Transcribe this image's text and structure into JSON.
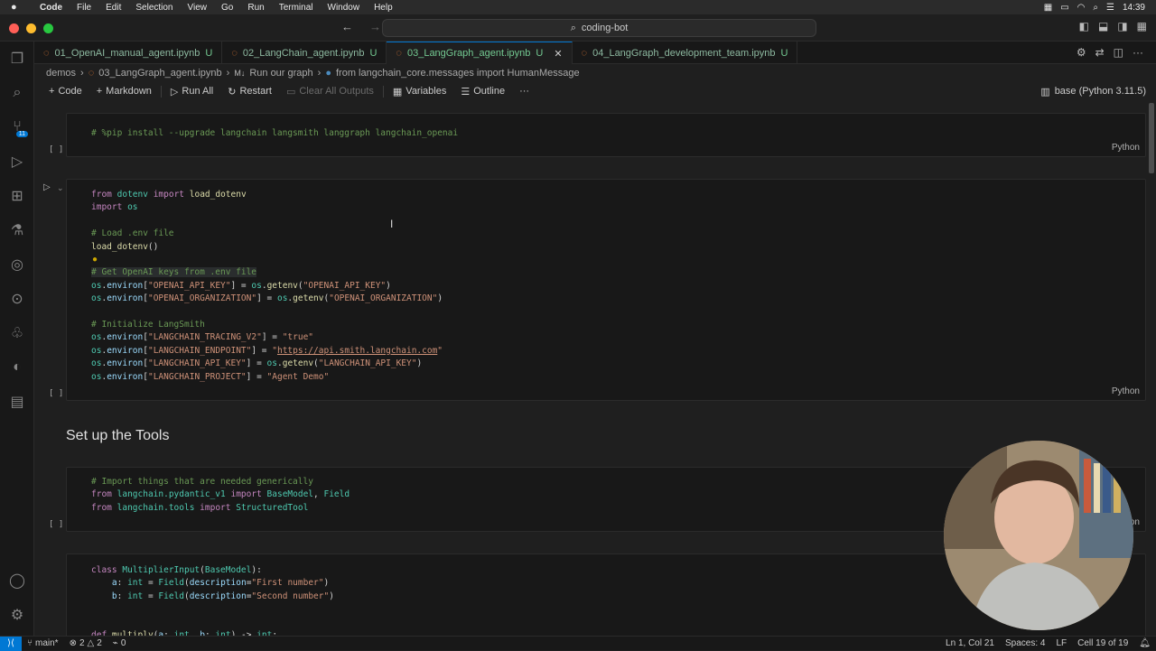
{
  "menubar": {
    "apple": "",
    "items": [
      "Code",
      "File",
      "Edit",
      "Selection",
      "View",
      "Go",
      "Run",
      "Terminal",
      "Window",
      "Help"
    ],
    "clock": "14:39"
  },
  "titlebar": {
    "search_text": "coding-bot"
  },
  "tabs": [
    {
      "label": "01_OpenAI_manual_agent.ipynb",
      "status": "U"
    },
    {
      "label": "02_LangChain_agent.ipynb",
      "status": "U"
    },
    {
      "label": "03_LangGraph_agent.ipynb",
      "status": "U",
      "active": true
    },
    {
      "label": "04_LangGraph_development_team.ipynb",
      "status": "U"
    }
  ],
  "activity": {
    "scm_badge": "11"
  },
  "breadcrumbs": {
    "folder": "demos",
    "file": "03_LangGraph_agent.ipynb",
    "md_section": "Run our graph",
    "symbol": "from langchain_core.messages import HumanMessage"
  },
  "toolbar": {
    "code": "Code",
    "markdown": "Markdown",
    "run_all": "Run All",
    "restart": "Restart",
    "clear_outputs": "Clear All Outputs",
    "variables": "Variables",
    "outline": "Outline",
    "more": "···",
    "kernel": "base (Python 3.11.5)"
  },
  "cells": {
    "lang": "Python",
    "exec_label": "[ ]",
    "cell1": {
      "line1": "# %pip install --upgrade langchain langsmith langgraph langchain_openai"
    },
    "heading": "Set up the Tools"
  },
  "statusbar": {
    "branch": "main*",
    "errors": "2",
    "warnings": "2",
    "ports": "0",
    "position": "Ln 1, Col 21",
    "spaces": "Spaces: 4",
    "eol": "LF",
    "cell_count": "Cell 19 of 19"
  },
  "colors": {
    "accent": "#0078d4",
    "modified_green": "#73c991",
    "notebook_orange": "#e37933"
  }
}
